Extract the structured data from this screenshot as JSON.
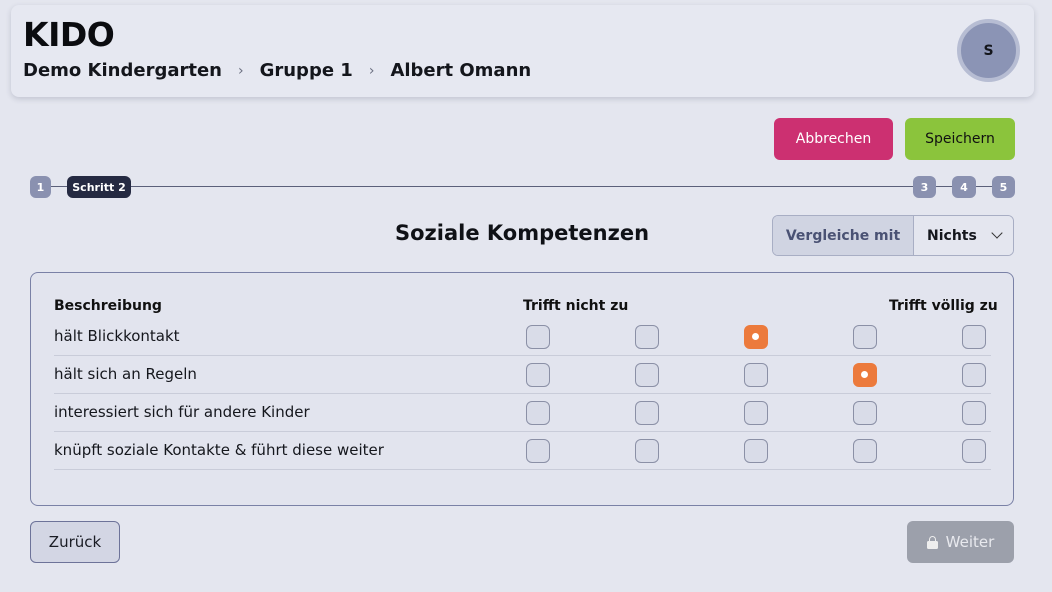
{
  "app": {
    "title": "KIDO"
  },
  "breadcrumb": {
    "items": [
      "Demo Kindergarten",
      "Gruppe 1",
      "Albert Omann"
    ],
    "separator": "›"
  },
  "user": {
    "avatar_initial": "S"
  },
  "actions": {
    "cancel_label": "Abbrechen",
    "save_label": "Speichern",
    "cancel_color": "#cc3071",
    "save_color": "#8bc43c"
  },
  "stepper": {
    "steps": [
      {
        "label": "1",
        "active": false
      },
      {
        "label": "Schritt 2",
        "active": true
      },
      {
        "label": "3",
        "active": false
      },
      {
        "label": "4",
        "active": false
      },
      {
        "label": "5",
        "active": false
      }
    ]
  },
  "section": {
    "title": "Soziale Kompetenzen"
  },
  "compare": {
    "label": "Vergleiche mit",
    "selected": "Nichts"
  },
  "table": {
    "col_description": "Beschreibung",
    "scale_low": "Trifft nicht zu",
    "scale_high": "Trifft völlig zu",
    "accent_color": "#ec7a3c",
    "rows": [
      {
        "text": "hält Blickkontakt",
        "selected": 3
      },
      {
        "text": "hält sich an Regeln",
        "selected": 4
      },
      {
        "text": "interessiert sich für andere Kinder",
        "selected": null
      },
      {
        "text": "knüpft soziale Kontakte & führt diese weiter",
        "selected": null
      }
    ]
  },
  "footer": {
    "back_label": "Zurück",
    "next_label": "Weiter",
    "next_icon": "lock-icon",
    "next_disabled": true
  }
}
